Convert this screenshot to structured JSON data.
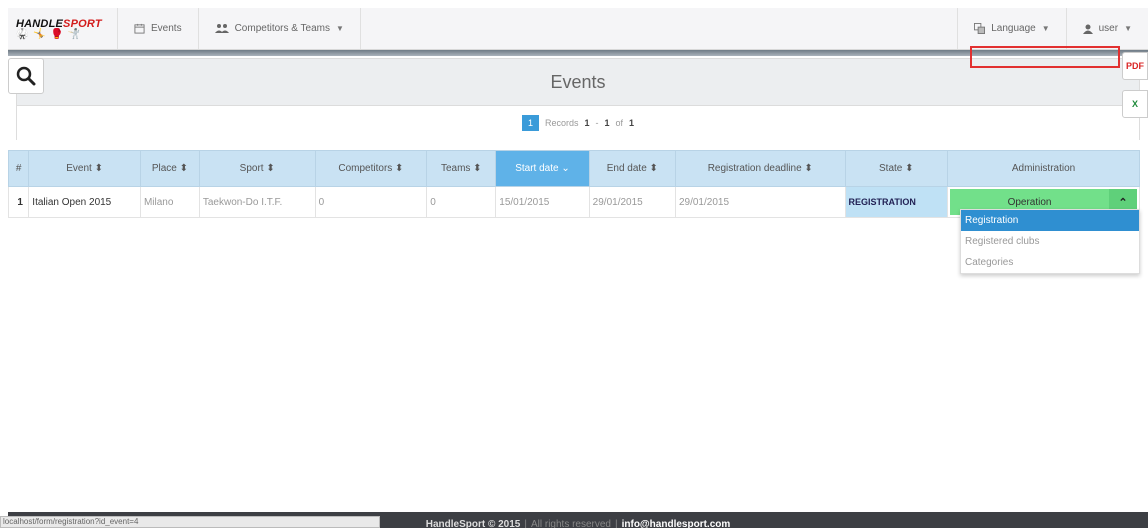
{
  "navbar": {
    "brand": "HANDLESPORT",
    "brand_prefix": "HANDLE",
    "brand_suffix": "SPORT",
    "brand_figures": "🥋 🤸 🥊 🤺",
    "events_label": "Events",
    "competitors_label": "Competitors & Teams",
    "language_label": "Language",
    "user_label": "user"
  },
  "icons": {
    "calendar": "calendar-icon",
    "users": "users-icon",
    "translate": "language-icon",
    "user": "user-icon",
    "search": "search-icon",
    "pdf": "pdf-icon",
    "excel": "excel-icon"
  },
  "side": {
    "pdf_glyph": "PDF",
    "xls_glyph": "X"
  },
  "panel": {
    "title": "Events",
    "page": "1",
    "records_prefix": "Records",
    "records_from": "1",
    "records_to": "1",
    "records_of": "of",
    "records_total": "1"
  },
  "table": {
    "headers": [
      "#",
      "Event ⬍",
      "Place ⬍",
      "Sport ⬍",
      "Competitors ⬍",
      "Teams ⬍",
      "Start date ⌄",
      "End date ⬍",
      "Registration deadline ⬍",
      "State ⬍",
      "Administration"
    ],
    "rows": [
      {
        "num": "1",
        "event": "Italian Open 2015",
        "place": "Milano",
        "sport": "Taekwon-Do I.T.F.",
        "competitors": "0",
        "teams": "0",
        "start": "15/01/2015",
        "end": "29/01/2015",
        "deadline": "29/01/2015",
        "state": "REGISTRATION",
        "operation": "Operation"
      }
    ]
  },
  "dropdown": {
    "items": [
      "Registration",
      "Registered clubs",
      "Categories"
    ]
  },
  "footer": {
    "copyright": "HandleSport © 2015",
    "separator": "|",
    "rights": "All rights reserved",
    "email": "info@handlesport.com"
  },
  "status_url": "localhost/form/registration?id_event=4",
  "colors": {
    "accent": "#3a9bd9",
    "operation": "#72e08a",
    "state": "#bfe1f5",
    "highlight": "#e23030"
  }
}
